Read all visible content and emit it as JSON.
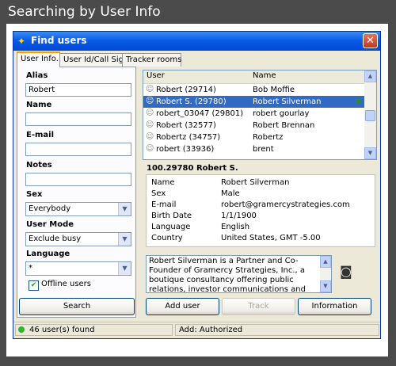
{
  "page_title": "Searching by User Info",
  "window": {
    "title": "Find users",
    "close": "✕"
  },
  "tabs": [
    {
      "label": "User Info."
    },
    {
      "label": "User Id/Call Sign"
    },
    {
      "label": "Tracker rooms"
    }
  ],
  "form": {
    "alias_label": "Alias",
    "alias_value": "Robert",
    "name_label": "Name",
    "name_value": "",
    "email_label": "E-mail",
    "email_value": "",
    "notes_label": "Notes",
    "notes_value": "",
    "sex_label": "Sex",
    "sex_value": "Everybody",
    "usermode_label": "User Mode",
    "usermode_value": "Exclude busy",
    "language_label": "Language",
    "language_value": "*",
    "offline_label": "Offline users",
    "offline_checked": true,
    "search_button": "Search"
  },
  "results": {
    "col_user": "User",
    "col_name": "Name",
    "rows": [
      {
        "user": "Robert (29714)",
        "name": "Bob Moffie"
      },
      {
        "user": "Robert S. (29780)",
        "name": "Robert Silverman",
        "selected": true
      },
      {
        "user": "robert_03047 (29801)",
        "name": "robert gourlay"
      },
      {
        "user": "Robert (32577)",
        "name": "Robert Brennan"
      },
      {
        "user": "Robertz (34757)",
        "name": "Robertz"
      },
      {
        "user": "robert (33936)",
        "name": "brent"
      }
    ]
  },
  "details": {
    "header": "100.29780 Robert S.",
    "rows": [
      {
        "k": "Name",
        "v": "Robert Silverman"
      },
      {
        "k": "Sex",
        "v": "Male"
      },
      {
        "k": "E-mail",
        "v": "robert@gramercystrategies.com"
      },
      {
        "k": "Birth Date",
        "v": "1/1/1900"
      },
      {
        "k": "Language",
        "v": "English"
      },
      {
        "k": "Country",
        "v": "United States, GMT -5.00"
      }
    ],
    "bio": "Robert Silverman is a Partner and Co-Founder of Gramercy Strategies, Inc., a boutique consultancy offering public relations, investor communications and industry relations services"
  },
  "actions": {
    "add_user": "Add user",
    "track": "Track",
    "information": "Information"
  },
  "status": {
    "found": "46 user(s) found",
    "add": "Add: Authorized"
  }
}
